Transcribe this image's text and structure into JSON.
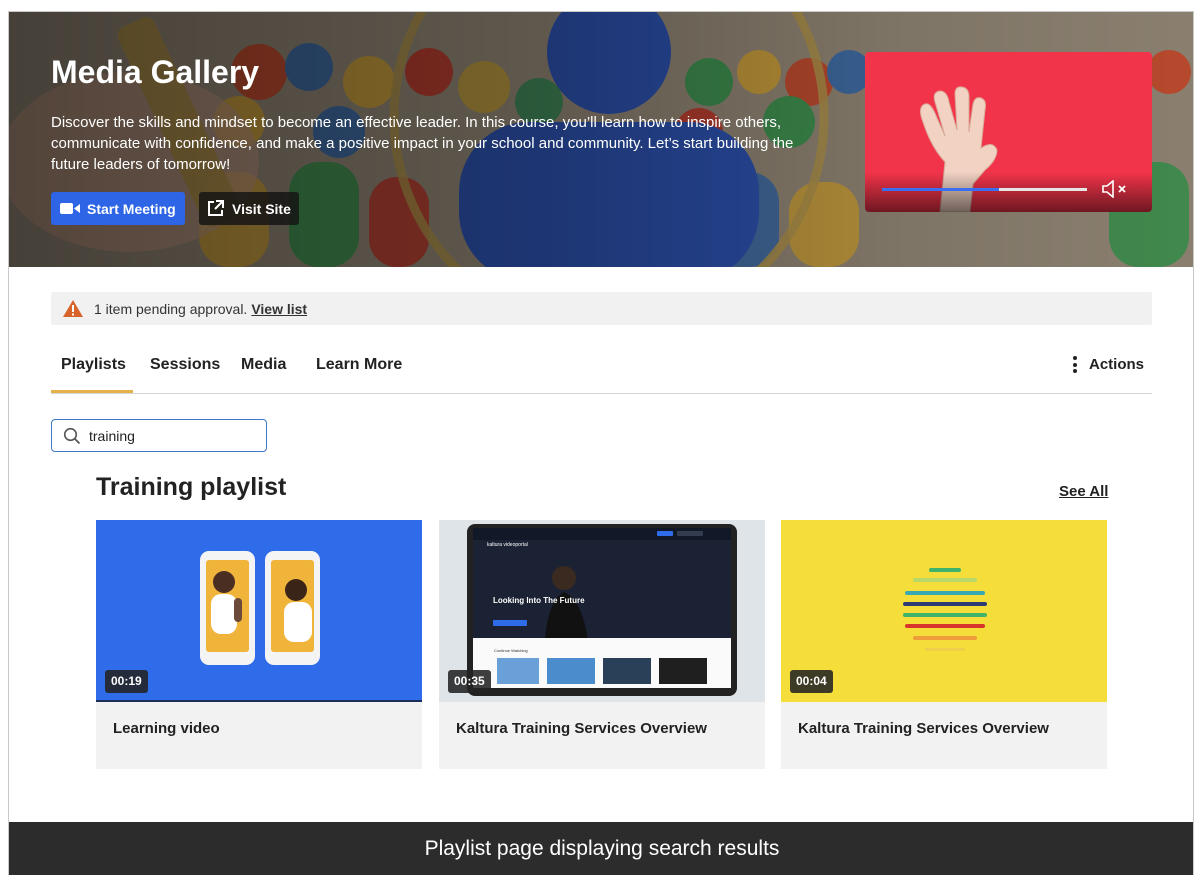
{
  "hero": {
    "title": "Media Gallery",
    "description": "Discover the skills and mindset to become an effective leader. In this course, you’ll learn how to inspire others, communicate with confidence, and make a positive impact in your school and community. Let’s start building the future leaders of tomorrow!",
    "start_meeting_label": "Start Meeting",
    "visit_site_label": "Visit Site",
    "player": {
      "progress": 0.57,
      "background": "#f2344a"
    }
  },
  "alert": {
    "text": "1 item pending approval.",
    "link": "View list"
  },
  "tabs": {
    "items": [
      "Playlists",
      "Sessions",
      "Media",
      "Learn More"
    ],
    "active": "Playlists",
    "actions_label": "Actions"
  },
  "search": {
    "value": "training"
  },
  "playlist": {
    "title": "Training playlist",
    "see_all": "See All",
    "cards": [
      {
        "duration": "00:19",
        "title": "Learning video"
      },
      {
        "duration": "00:35",
        "title": "Kaltura Training Services Overview"
      },
      {
        "duration": "00:04",
        "title": "Kaltura Training Services Overview"
      }
    ]
  },
  "thumbnail_text": {
    "brand": "kaltura videoportal",
    "headline": "Looking Into The Future",
    "row_label": "Continue Watching"
  },
  "caption": "Playlist page displaying search results",
  "colors": {
    "accent_blue": "#2e64e6",
    "tab_underline": "#e6b14a",
    "card_bg": "#f2f2f2",
    "caption_bg": "#2c2c2c"
  },
  "icons": [
    "video-camera-icon",
    "external-link-icon",
    "volume-muted-icon",
    "warning-icon",
    "kebab-icon",
    "search-icon"
  ]
}
